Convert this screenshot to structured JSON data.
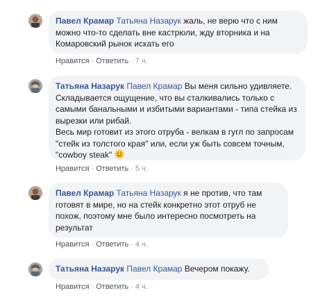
{
  "comments": [
    {
      "author": "Павел Крамар",
      "mention": "Татьяна Назарук",
      "text": "жаль, не верю что с ним можно что-то сделать вне кастрюли, жду вторника и на Комаровский рынок искать его",
      "like": "Нравится",
      "reply": "Ответить",
      "time": "7 ч."
    },
    {
      "author": "Татьяна Назарук",
      "mention": "Павел Крамар",
      "text": "Вы меня сильно удивляете. Складывается ощущение, что вы сталкивались только с самыми банальными и избитыми вариантами - типа стейка из вырезки или рибай.",
      "text2": "Весь мир готовит из этого отруба - велкам в гугл по запросам \"стейк из толстого края\" или, если уж быть совсем точным, \"cowboy steak\"",
      "like": "Нравится",
      "reply": "Ответить",
      "time": "5 ч."
    },
    {
      "author": "Павел Крамар",
      "mention": "Татьяна Назарук",
      "text": "я не против, что там готовят в мире, но на стейк конкретно этот отруб не похож, поэтому мне было интересно посмотреть на результат",
      "like": "Нравится",
      "reply": "Ответить",
      "time": "4 ч."
    },
    {
      "author": "Татьяна Назарук",
      "mention": "Павел Крамар",
      "text": "Вечером покажу.",
      "like": "Нравится",
      "reply": "Ответить",
      "time": "4 ч."
    }
  ],
  "separator": "·",
  "colors": {
    "link": "#385898",
    "bubble": "#f2f3f5",
    "meta": "#90949c"
  },
  "icons": {
    "smile": "smile-emoji-icon"
  }
}
